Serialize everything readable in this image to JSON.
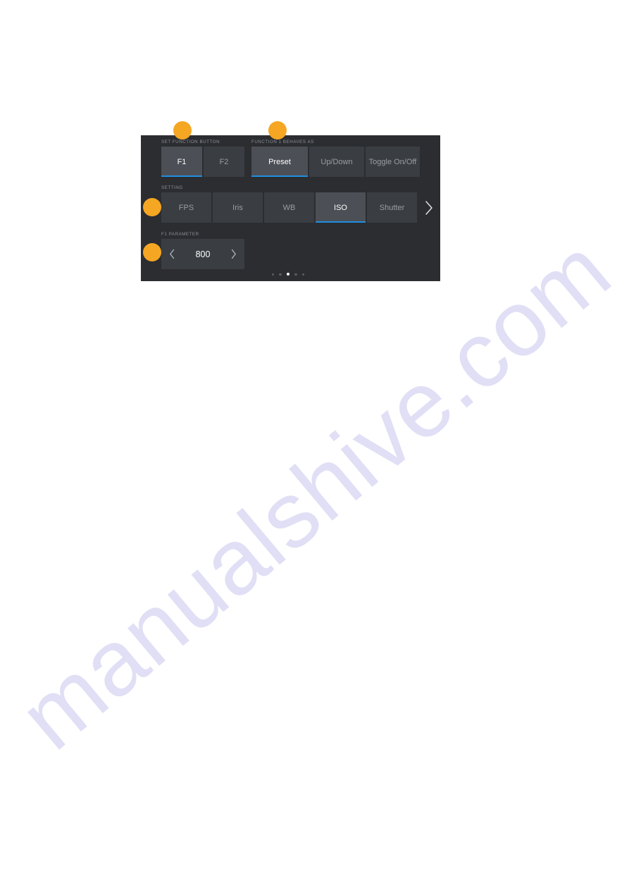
{
  "watermark": {
    "text": "manualshive.com"
  },
  "colors": {
    "panel_bg": "#2b2d31",
    "button_bg": "#3a3d42",
    "button_selected_bg": "#4c4f55",
    "accent_blue": "#1f8fe0",
    "callout_orange": "#f5a623",
    "label_gray": "#8c9097",
    "text_dim": "#9a9ea5",
    "text_bright": "#ffffff"
  },
  "panel": {
    "function_button": {
      "label": "SET FUNCTION BUTTON",
      "options": [
        {
          "label": "F1",
          "selected": true
        },
        {
          "label": "F2",
          "selected": false
        }
      ]
    },
    "behaves_as": {
      "label": "FUNCTION 1 BEHAVES AS",
      "options": [
        {
          "label": "Preset",
          "selected": true
        },
        {
          "label": "Up/Down",
          "selected": false
        },
        {
          "label": "Toggle On/Off",
          "selected": false
        }
      ]
    },
    "setting": {
      "label": "SETTING",
      "options": [
        {
          "label": "FPS",
          "selected": false
        },
        {
          "label": "Iris",
          "selected": false
        },
        {
          "label": "WB",
          "selected": false
        },
        {
          "label": "ISO",
          "selected": true
        },
        {
          "label": "Shutter",
          "selected": false
        }
      ],
      "scroll_next_icon": "chevron-right-icon"
    },
    "parameter": {
      "label": "F1 PARAMETER",
      "value": "800",
      "decrement_icon": "chevron-left-icon",
      "increment_icon": "chevron-right-icon"
    },
    "pagination": {
      "total": 5,
      "active_index": 3
    }
  },
  "callouts": [
    {
      "name": "callout-1"
    },
    {
      "name": "callout-2"
    },
    {
      "name": "callout-3"
    },
    {
      "name": "callout-4"
    }
  ]
}
